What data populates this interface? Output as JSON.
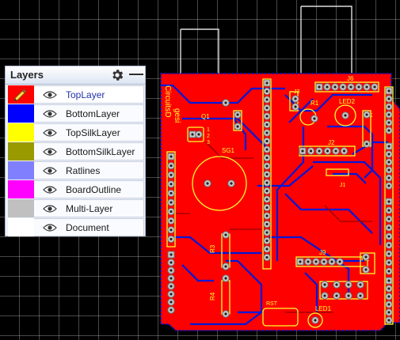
{
  "layers_panel": {
    "title": "Layers",
    "settings_icon": "gear-icon",
    "minimize_label": "—",
    "layers": [
      {
        "name": "TopLayer",
        "color": "#ff0000",
        "active": true,
        "edit_icon": "pencil-icon"
      },
      {
        "name": "BottomLayer",
        "color": "#0000ff"
      },
      {
        "name": "TopSilkLayer",
        "color": "#ffff00"
      },
      {
        "name": "BottomSilkLayer",
        "color": "#999900"
      },
      {
        "name": "Ratlines",
        "color": "#8080ff"
      },
      {
        "name": "BoardOutline",
        "color": "#ff00ff"
      },
      {
        "name": "Multi-Layer",
        "color": "#c0c0c0"
      },
      {
        "name": "Document",
        "color": "#ffffff"
      }
    ],
    "visibility_icon": "eye-icon"
  },
  "board": {
    "colors": {
      "copper_top": "#ff0000",
      "copper_bottom": "#0018d8",
      "silk": "#ffff33",
      "pad": "#c9c9c9"
    },
    "labels": {
      "brand": "CircuitsD",
      "brand2": "gesi",
      "j6": "J6",
      "r1": "R1",
      "led2": "LED2",
      "q1": "Q1",
      "sg1": "SG1",
      "j2": "J2",
      "r3": "R3",
      "r4": "R4",
      "j9": "J9",
      "led1": "LED1",
      "r2": "R2",
      "j1": "J1",
      "j3": "J3",
      "rst": "RST",
      "k": "K",
      "pin1": "1",
      "pin2": "2",
      "pin3": "3"
    }
  }
}
